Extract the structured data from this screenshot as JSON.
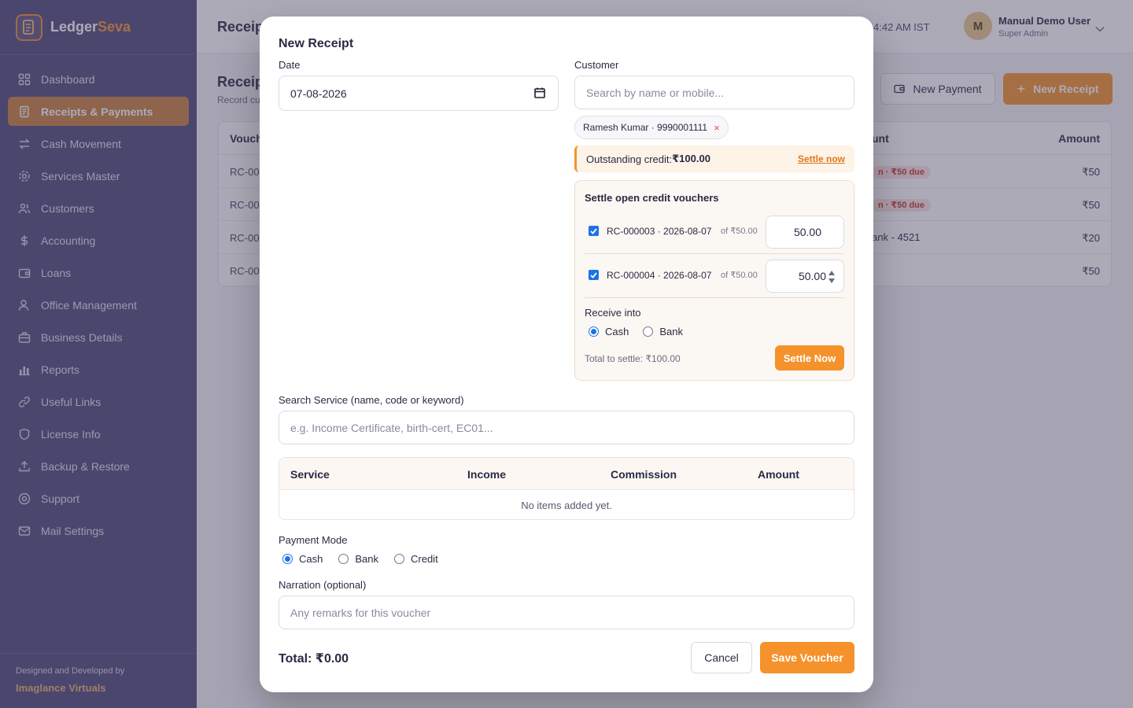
{
  "brand": {
    "name_part1": "Ledger",
    "name_part2": "Seva"
  },
  "sidebar": {
    "items": [
      {
        "label": "Dashboard",
        "icon": "grid-icon"
      },
      {
        "label": "Receipts & Payments",
        "icon": "receipt-icon"
      },
      {
        "label": "Cash Movement",
        "icon": "swap-icon"
      },
      {
        "label": "Services Master",
        "icon": "gear-icon"
      },
      {
        "label": "Customers",
        "icon": "users-icon"
      },
      {
        "label": "Accounting",
        "icon": "dollar-icon"
      },
      {
        "label": "Loans",
        "icon": "wallet-icon"
      },
      {
        "label": "Office Management",
        "icon": "user-icon"
      },
      {
        "label": "Business Details",
        "icon": "briefcase-icon"
      },
      {
        "label": "Reports",
        "icon": "bar-chart-icon"
      },
      {
        "label": "Useful Links",
        "icon": "link-icon"
      },
      {
        "label": "License Info",
        "icon": "shield-icon"
      },
      {
        "label": "Backup & Restore",
        "icon": "upload-icon"
      },
      {
        "label": "Support",
        "icon": "support-icon"
      },
      {
        "label": "Mail Settings",
        "icon": "mail-icon"
      }
    ],
    "active_index": 1,
    "footer_line1": "Designed and Developed by",
    "footer_line2": "Imaglance Virtuals"
  },
  "topbar": {
    "title": "Receip",
    "clock": "4:42 AM IST",
    "avatar_initial": "M",
    "user_name": "Manual Demo User",
    "user_role": "Super Admin"
  },
  "page": {
    "section_title": "Receip",
    "section_sub": "Record cu",
    "new_payment_label": "New Payment",
    "new_receipt_label": "New Receipt",
    "table": {
      "headers": [
        "Vouch",
        "unt",
        "Amount"
      ],
      "rows": [
        {
          "voucher": "RC-00",
          "status": "n · ₹50 due",
          "amount": "₹50"
        },
        {
          "voucher": "RC-00",
          "status": "n · ₹50 due",
          "amount": "₹50"
        },
        {
          "voucher": "RC-00",
          "status": "ank - 4521",
          "amount": "₹20"
        },
        {
          "voucher": "RC-00",
          "status": "",
          "amount": "₹50"
        }
      ]
    }
  },
  "modal": {
    "title": "New Receipt",
    "date_label": "Date",
    "date_value": "07-08-2026",
    "customer_label": "Customer",
    "customer_placeholder": "Search by name or mobile...",
    "customer_chip": "Ramesh Kumar · 9990001111",
    "chip_remove": "×",
    "outstanding_prefix": "Outstanding credit: ",
    "outstanding_amount": "₹100.00",
    "settle_link": "Settle now",
    "settle_box": {
      "title": "Settle open credit vouchers",
      "rows": [
        {
          "ref": "RC-000003 · 2026-08-07",
          "of": "of ₹50.00",
          "amount": "50.00",
          "checked": true
        },
        {
          "ref": "RC-000004 · 2026-08-07",
          "of": "of ₹50.00",
          "amount": "50.00",
          "checked": true
        }
      ],
      "receive_label": "Receive into",
      "receive_options": [
        "Cash",
        "Bank"
      ],
      "receive_selected": "Cash",
      "total_text": "Total to settle: ₹100.00",
      "settle_button": "Settle Now"
    },
    "service_label": "Search Service (name, code or keyword)",
    "service_placeholder": "e.g. Income Certificate, birth-cert, EC01...",
    "service_table": {
      "headers": [
        "Service",
        "Income",
        "Commission",
        "Amount"
      ],
      "empty_text": "No items added yet."
    },
    "payment_mode_label": "Payment Mode",
    "payment_modes": [
      "Cash",
      "Bank",
      "Credit"
    ],
    "payment_mode_selected": "Cash",
    "narration_label": "Narration (optional)",
    "narration_placeholder": "Any remarks for this voucher",
    "total_text": "Total: ₹0.00",
    "cancel_label": "Cancel",
    "save_label": "Save Voucher"
  },
  "colors": {
    "accent": "#f5922c",
    "sidebar": "#4f4a7a",
    "active_nav": "#c9803e",
    "link": "#e0781b"
  }
}
